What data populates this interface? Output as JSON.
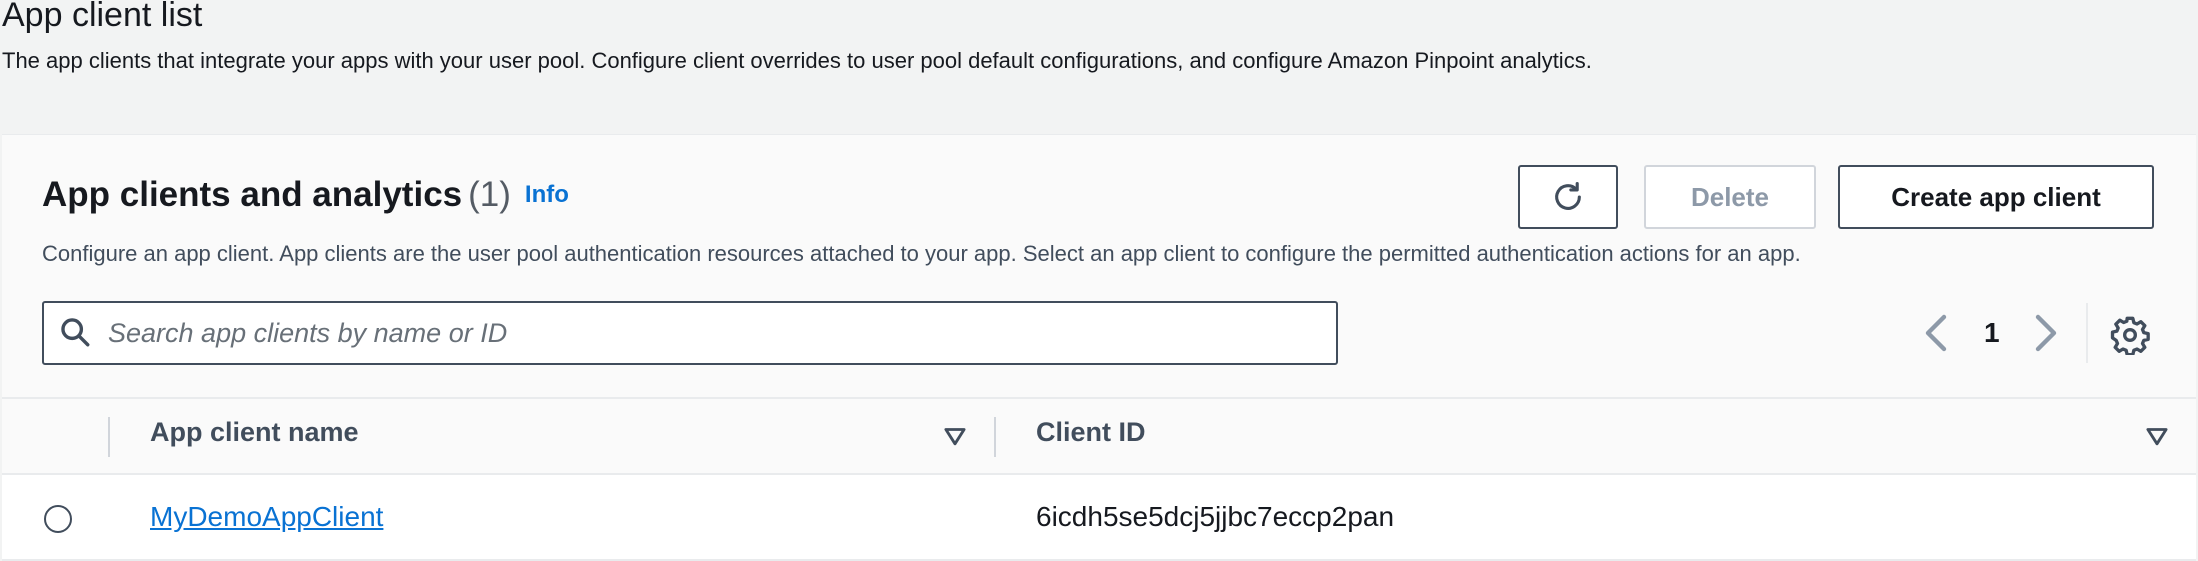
{
  "page": {
    "title": "App client list",
    "description": "The app clients that integrate your apps with your user pool. Configure client overrides to user pool default configurations, and configure Amazon Pinpoint analytics."
  },
  "section": {
    "title": "App clients and analytics",
    "count": "(1)",
    "info": "Info",
    "description": "Configure an app client. App clients are the user pool authentication resources attached to your app. Select an app client to configure the permitted authentication actions for an app."
  },
  "actions": {
    "refresh_icon": "refresh-icon",
    "delete_label": "Delete",
    "create_label": "Create app client"
  },
  "search": {
    "placeholder": "Search app clients by name or ID",
    "value": ""
  },
  "pagination": {
    "current_page": "1"
  },
  "table": {
    "columns": [
      "App client name",
      "Client ID"
    ],
    "rows": [
      {
        "name": "MyDemoAppClient",
        "client_id": "6icdh5se5dcj5jjbc7eccp2pan"
      }
    ]
  },
  "colors": {
    "link": "#0972d3",
    "background": "#f2f3f3",
    "border": "#414d5c"
  }
}
